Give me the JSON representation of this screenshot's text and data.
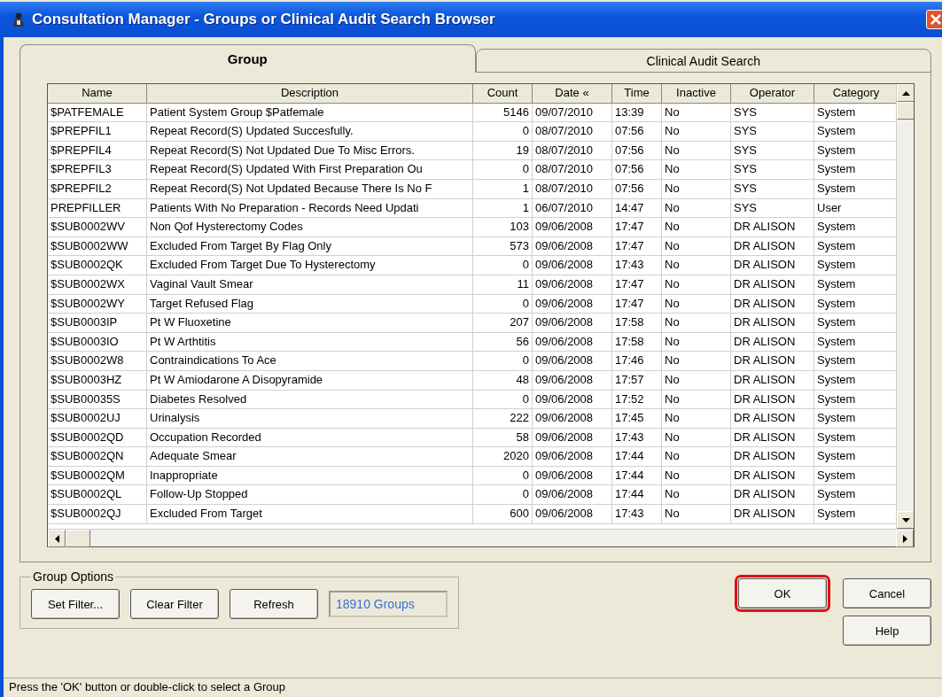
{
  "window": {
    "title": "Consultation Manager - Groups or Clinical Audit Search Browser"
  },
  "tabs": [
    {
      "label": "Group",
      "selected": true
    },
    {
      "label": "Clinical Audit Search",
      "selected": false
    }
  ],
  "table": {
    "columns": [
      "Name",
      "Description",
      "Count",
      "Date «",
      "Time",
      "Inactive",
      "Operator",
      "Category"
    ],
    "rows": [
      [
        "$PATFEMALE",
        "Patient System Group $Patfemale",
        "5146",
        "09/07/2010",
        "13:39",
        "No",
        "SYS",
        "System"
      ],
      [
        "$PREPFIL1",
        "Repeat Record(S) Updated Succesfully.",
        "0",
        "08/07/2010",
        "07:56",
        "No",
        "SYS",
        "System"
      ],
      [
        "$PREPFIL4",
        "Repeat Record(S) Not Updated Due To Misc Errors.",
        "19",
        "08/07/2010",
        "07:56",
        "No",
        "SYS",
        "System"
      ],
      [
        "$PREPFIL3",
        "Repeat Record(S) Updated With First Preparation Ou",
        "0",
        "08/07/2010",
        "07:56",
        "No",
        "SYS",
        "System"
      ],
      [
        "$PREPFIL2",
        "Repeat Record(S) Not Updated Because There Is No F",
        "1",
        "08/07/2010",
        "07:56",
        "No",
        "SYS",
        "System"
      ],
      [
        "PREPFILLER",
        "Patients With No Preparation - Records Need Updati",
        "1",
        "06/07/2010",
        "14:47",
        "No",
        "SYS",
        "User"
      ],
      [
        "$SUB0002WV",
        "Non Qof Hysterectomy Codes",
        "103",
        "09/06/2008",
        "17:47",
        "No",
        "DR ALISON",
        "System"
      ],
      [
        "$SUB0002WW",
        "Excluded From Target By Flag Only",
        "573",
        "09/06/2008",
        "17:47",
        "No",
        "DR ALISON",
        "System"
      ],
      [
        "$SUB0002QK",
        "Excluded From Target Due To Hysterectomy",
        "0",
        "09/06/2008",
        "17:43",
        "No",
        "DR ALISON",
        "System"
      ],
      [
        "$SUB0002WX",
        "Vaginal Vault Smear",
        "11",
        "09/06/2008",
        "17:47",
        "No",
        "DR ALISON",
        "System"
      ],
      [
        "$SUB0002WY",
        "Target Refused Flag",
        "0",
        "09/06/2008",
        "17:47",
        "No",
        "DR ALISON",
        "System"
      ],
      [
        "$SUB0003IP",
        "Pt W Fluoxetine",
        "207",
        "09/06/2008",
        "17:58",
        "No",
        "DR ALISON",
        "System"
      ],
      [
        "$SUB0003IO",
        "Pt W Arthtitis",
        "56",
        "09/06/2008",
        "17:58",
        "No",
        "DR ALISON",
        "System"
      ],
      [
        "$SUB0002W8",
        "Contraindications To Ace",
        "0",
        "09/06/2008",
        "17:46",
        "No",
        "DR ALISON",
        "System"
      ],
      [
        "$SUB0003HZ",
        "Pt W Amiodarone A Disopyramide",
        "48",
        "09/06/2008",
        "17:57",
        "No",
        "DR ALISON",
        "System"
      ],
      [
        "$SUB00035S",
        "Diabetes Resolved",
        "0",
        "09/06/2008",
        "17:52",
        "No",
        "DR ALISON",
        "System"
      ],
      [
        "$SUB0002UJ",
        "Urinalysis",
        "222",
        "09/06/2008",
        "17:45",
        "No",
        "DR ALISON",
        "System"
      ],
      [
        "$SUB0002QD",
        "Occupation Recorded",
        "58",
        "09/06/2008",
        "17:43",
        "No",
        "DR ALISON",
        "System"
      ],
      [
        "$SUB0002QN",
        "Adequate Smear",
        "2020",
        "09/06/2008",
        "17:44",
        "No",
        "DR ALISON",
        "System"
      ],
      [
        "$SUB0002QM",
        "Inappropriate",
        "0",
        "09/06/2008",
        "17:44",
        "No",
        "DR ALISON",
        "System"
      ],
      [
        "$SUB0002QL",
        "Follow-Up Stopped",
        "0",
        "09/06/2008",
        "17:44",
        "No",
        "DR ALISON",
        "System"
      ],
      [
        "$SUB0002QJ",
        "Excluded From Target",
        "600",
        "09/06/2008",
        "17:43",
        "No",
        "DR ALISON",
        "System"
      ]
    ]
  },
  "group_options": {
    "title": "Group Options",
    "buttons": [
      "Set Filter...",
      "Clear Filter",
      "Refresh"
    ],
    "count": "18910 Groups"
  },
  "dialog_buttons": [
    {
      "label": "OK",
      "highlighted": true
    },
    {
      "label": "Cancel",
      "highlighted": false
    },
    {
      "label": "Help",
      "highlighted": false
    }
  ],
  "status_bar": "Press the 'OK' button or double-click to select a Group"
}
